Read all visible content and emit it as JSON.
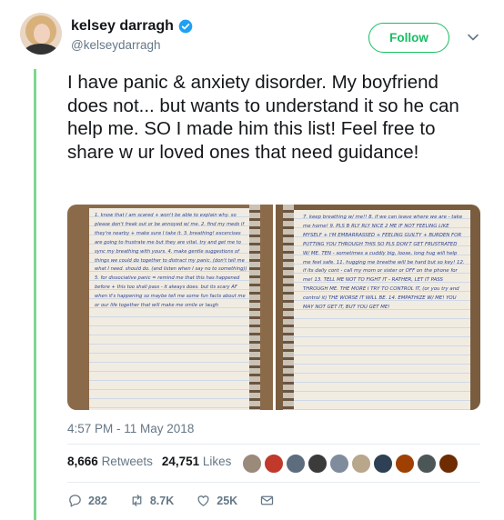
{
  "author": {
    "display_name": "kelsey darragh",
    "handle": "@kelseydarragh",
    "verified": true,
    "avatar_icon": "profile-photo"
  },
  "follow_label": "Follow",
  "tweet_text": "I have panic & anxiety disorder. My boyfriend does not... but wants to understand it so he can help me. SO I made him this list! Feel free to share w ur loved ones that need guidance!",
  "photos": {
    "left_page": "1. know that I am scared + won't be able to explain why. so please don't freak out or be annoyed w/ me. 2. find my meds if they're nearby + make sure I take it. 3. breathing! excercises are going to frustrate me but they are vital. try and get me to sync my breathing with yours. 4. make gentle suggestions of things we could do together to distract my panic. (don't tell me what I need. should do. (and listen when I say no to something)) 5. for dissociative panic = remind me that this has happened before + this too shall pass - it always does. but its scary AF when it's happening so maybe tell me some fun facts about me or our life together that will make me smile or laugh",
    "right_page": "7. keep breathing w/ me!! 8. if we can leave where we are - take me home! 9. PLS B RLY RLY NICE 2 ME IF NOT FEELING LIKE MYSELF + I'M EMBARRASSED + FEELING GUILTY + BURDEN FOR PUTTING YOU THROUGH THIS SO PLS DON'T GET FRUSTRATED W/ ME. TEN - sometimes a cuddly big, loose, long hug will help me feel safe. 11. hugging me breathe will be hard but so key! 12. if its daily cont - call my mom or sister or OFF on the phone for me! 13. TELL ME NOT TO FIGHT IT - RATHER, LET IT PASS THROUGH ME. THE MORE I TRY TO CONTROL IT, (or you try and control it) THE WORSE IT WILL BE. 14. EMPATHIZE W/ ME! YOU MAY NOT GET IT, BUT YOU GET ME!"
  },
  "timestamp": "4:57 PM - 11 May 2018",
  "stats": {
    "retweets_count": "8,666",
    "retweets_label": "Retweets",
    "likes_count": "24,751",
    "likes_label": "Likes"
  },
  "liker_avatar_colors": [
    "#9a8a7a",
    "#c0392b",
    "#5d6d7e",
    "#3b3b3b",
    "#7f8c9d",
    "#b8a78a",
    "#2e4053",
    "#a04000",
    "#4d5656",
    "#6e2c00"
  ],
  "actions": {
    "replies": "282",
    "retweets": "8.7K",
    "likes": "25K"
  },
  "colors": {
    "follow_green": "#17bf63",
    "verified_blue": "#1da1f2",
    "muted_text": "#657786",
    "thread_rule": "#7bd88f"
  }
}
